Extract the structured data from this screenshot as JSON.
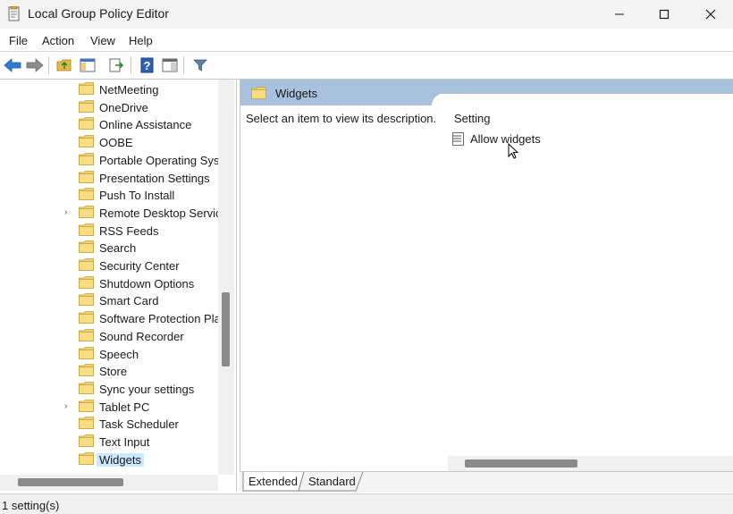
{
  "window": {
    "title": "Local Group Policy Editor",
    "minimize_icon": "minimize-icon",
    "maximize_icon": "maximize-icon",
    "close_icon": "close-icon"
  },
  "menu": [
    "File",
    "Action",
    "View",
    "Help"
  ],
  "toolbar": {
    "icons": [
      "back-arrow-icon",
      "forward-arrow-icon",
      "up-folder-icon",
      "show-hide-tree-icon",
      "export-list-icon",
      "help-icon",
      "show-hide-action-pane-icon",
      "filter-icon"
    ]
  },
  "tree": {
    "items": [
      {
        "label": "NetMeeting",
        "expandable": false,
        "selected": false
      },
      {
        "label": "OneDrive",
        "expandable": false,
        "selected": false
      },
      {
        "label": "Online Assistance",
        "expandable": false,
        "selected": false
      },
      {
        "label": "OOBE",
        "expandable": false,
        "selected": false
      },
      {
        "label": "Portable Operating Syst",
        "expandable": false,
        "selected": false
      },
      {
        "label": "Presentation Settings",
        "expandable": false,
        "selected": false
      },
      {
        "label": "Push To Install",
        "expandable": false,
        "selected": false
      },
      {
        "label": "Remote Desktop Servic",
        "expandable": true,
        "selected": false
      },
      {
        "label": "RSS Feeds",
        "expandable": false,
        "selected": false
      },
      {
        "label": "Search",
        "expandable": false,
        "selected": false
      },
      {
        "label": "Security Center",
        "expandable": false,
        "selected": false
      },
      {
        "label": "Shutdown Options",
        "expandable": false,
        "selected": false
      },
      {
        "label": "Smart Card",
        "expandable": false,
        "selected": false
      },
      {
        "label": "Software Protection Plat",
        "expandable": false,
        "selected": false
      },
      {
        "label": "Sound Recorder",
        "expandable": false,
        "selected": false
      },
      {
        "label": "Speech",
        "expandable": false,
        "selected": false
      },
      {
        "label": "Store",
        "expandable": false,
        "selected": false
      },
      {
        "label": "Sync your settings",
        "expandable": false,
        "selected": false
      },
      {
        "label": "Tablet PC",
        "expandable": true,
        "selected": false
      },
      {
        "label": "Task Scheduler",
        "expandable": false,
        "selected": false
      },
      {
        "label": "Text Input",
        "expandable": false,
        "selected": false
      },
      {
        "label": "Widgets",
        "expandable": false,
        "selected": true
      }
    ]
  },
  "details": {
    "header_title": "Widgets",
    "description_prompt": "Select an item to view its description.",
    "column_header": "Setting",
    "settings": [
      {
        "label": "Allow widgets"
      }
    ]
  },
  "tabs": [
    "Extended",
    "Standard"
  ],
  "status": "1 setting(s)",
  "colors": {
    "header_band": "#a8c1dd",
    "selection": "#cce8ff",
    "folder": "#f2d06b",
    "scroll_thumb": "#8a8a8a"
  }
}
